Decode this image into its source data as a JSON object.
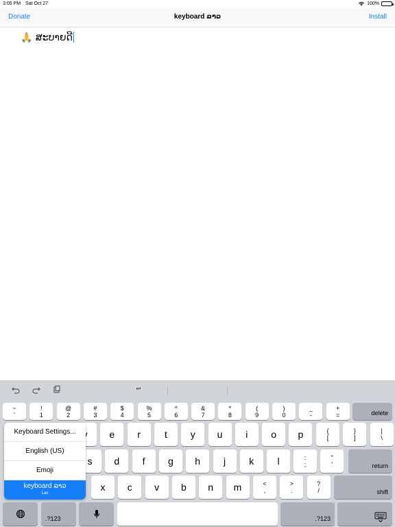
{
  "status": {
    "time": "3:05 PM",
    "date": "Sat Oct 27",
    "battery": "100%"
  },
  "nav": {
    "left": "Donate",
    "title": "keyboard ລາວ",
    "right": "Install"
  },
  "editor": {
    "emoji": "🙏",
    "text": "ສະບາຍດີ"
  },
  "shortcuts": {
    "quote": "“”",
    "icons": [
      "undo-icon",
      "redo-icon",
      "paste-icon"
    ]
  },
  "keys": {
    "row1": [
      {
        "top": "~",
        "bottom": "`"
      },
      {
        "top": "!",
        "bottom": "1"
      },
      {
        "top": "@",
        "bottom": "2"
      },
      {
        "top": "#",
        "bottom": "3"
      },
      {
        "top": "$",
        "bottom": "4"
      },
      {
        "top": "%",
        "bottom": "5"
      },
      {
        "top": "^",
        "bottom": "6"
      },
      {
        "top": "&",
        "bottom": "7"
      },
      {
        "top": "*",
        "bottom": "8"
      },
      {
        "top": "(",
        "bottom": "9"
      },
      {
        "top": ")",
        "bottom": "0"
      },
      {
        "top": "_",
        "bottom": "-"
      },
      {
        "top": "+",
        "bottom": "="
      }
    ],
    "delete": "delete",
    "row2": [
      "y",
      "e",
      "r",
      "t",
      "y",
      "u",
      "i",
      "o",
      "p"
    ],
    "row2_brackets": [
      {
        "top": "{",
        "bottom": "["
      },
      {
        "top": "}",
        "bottom": "]"
      },
      {
        "top": "|",
        "bottom": "\\"
      }
    ],
    "row3": [
      "s",
      "d",
      "f",
      "g",
      "h",
      "j",
      "k",
      "l"
    ],
    "row3_punct": [
      {
        "top": ":",
        "bottom": ";"
      },
      {
        "top": "\"",
        "bottom": "'"
      }
    ],
    "return": "return",
    "row4": [
      "x",
      "c",
      "v",
      "b",
      "n",
      "m"
    ],
    "row4_punct": [
      {
        "top": "<",
        "bottom": ","
      },
      {
        "top": ">",
        "bottom": "."
      },
      {
        "top": "?",
        "bottom": "/"
      }
    ],
    "shift": "shift",
    "numbers_left": ".?123",
    "numbers_right": ".?123"
  },
  "popup": {
    "items": [
      "Keyboard Settings...",
      "English (US)",
      "Emoji"
    ],
    "selected": {
      "label": "keyboard ລາວ",
      "sub": "Lao"
    }
  },
  "colors": {
    "accent": "#147efb",
    "keyboard_bg": "#d1d4d9",
    "dark_key": "#abb0ba"
  }
}
